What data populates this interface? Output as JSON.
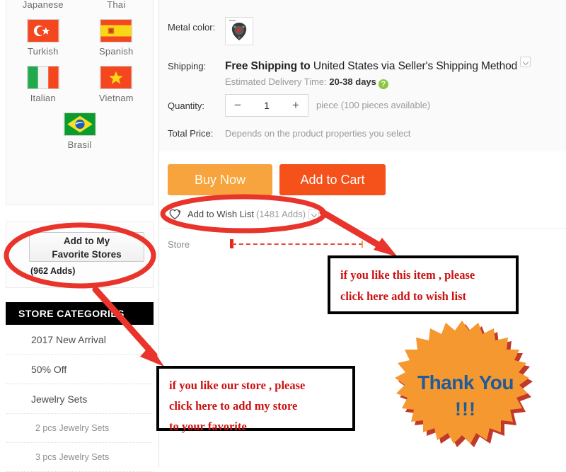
{
  "languages": [
    {
      "label": "Japanese",
      "flag": "japan-flag",
      "show_flag": false
    },
    {
      "label": "Thai",
      "flag": "thailand-flag",
      "show_flag": false
    },
    {
      "label": "Turkish",
      "flag": "turkey-flag",
      "show_flag": true
    },
    {
      "label": "Spanish",
      "flag": "spain-flag",
      "show_flag": true
    },
    {
      "label": "Italian",
      "flag": "italy-flag",
      "show_flag": true
    },
    {
      "label": "Vietnam",
      "flag": "vietnam-flag",
      "show_flag": true
    },
    {
      "label": "Brasil",
      "flag": "brazil-flag",
      "show_flag": true
    }
  ],
  "favorite": {
    "button_label_line1": "Add to My",
    "button_label_line2": "Favorite Stores",
    "adds_count": "(962 Adds)"
  },
  "categories": {
    "header": "STORE CATEGORIES",
    "items": [
      {
        "label": "2017 New Arrival",
        "sub": false
      },
      {
        "label": "50% Off",
        "sub": false
      },
      {
        "label": "Jewelry Sets",
        "sub": false
      },
      {
        "label": "2 pcs Jewelry Sets",
        "sub": true
      },
      {
        "label": "3 pcs Jewelry Sets",
        "sub": true
      }
    ]
  },
  "product": {
    "metal_color_label": "Metal color:",
    "shipping_label": "Shipping:",
    "shipping_free": "Free Shipping to",
    "shipping_dest": " United States via Seller's Shipping Method",
    "eta_label": "Estimated Delivery Time:",
    "eta_value": "20-38",
    "eta_unit": "days",
    "help_icon": "?",
    "quantity_label": "Quantity:",
    "quantity_minus": "−",
    "quantity_value": "1",
    "quantity_plus": "+",
    "quantity_suffix": "piece (100 pieces available)",
    "total_price_label": "Total Price:",
    "total_price_value": "Depends on the product properties you select",
    "store_label": "Store"
  },
  "actions": {
    "buy_now": "Buy Now",
    "add_to_cart": "Add to Cart",
    "wish_label": "Add to Wish List",
    "wish_count": "(1481 Adds)"
  },
  "annotations": {
    "wish_note": [
      "if  you like this item , please",
      "click here add to wish list"
    ],
    "store_note": [
      "if  you like our store , please",
      " click here to add my store",
      "to your favorite"
    ],
    "thanks_line1": "Thank You",
    "thanks_line2": "!!!"
  },
  "colors": {
    "buy_now": "#f7a43e",
    "add_to_cart": "#f5511b",
    "annotation_red": "#cc1111",
    "marker_red": "#e8342a",
    "starburst_orange": "#f5982f",
    "starburst_shadow": "#c0392b",
    "thanks_blue": "#1f5c99",
    "category_header_bg": "#000000",
    "help_green": "#8cc63e"
  }
}
